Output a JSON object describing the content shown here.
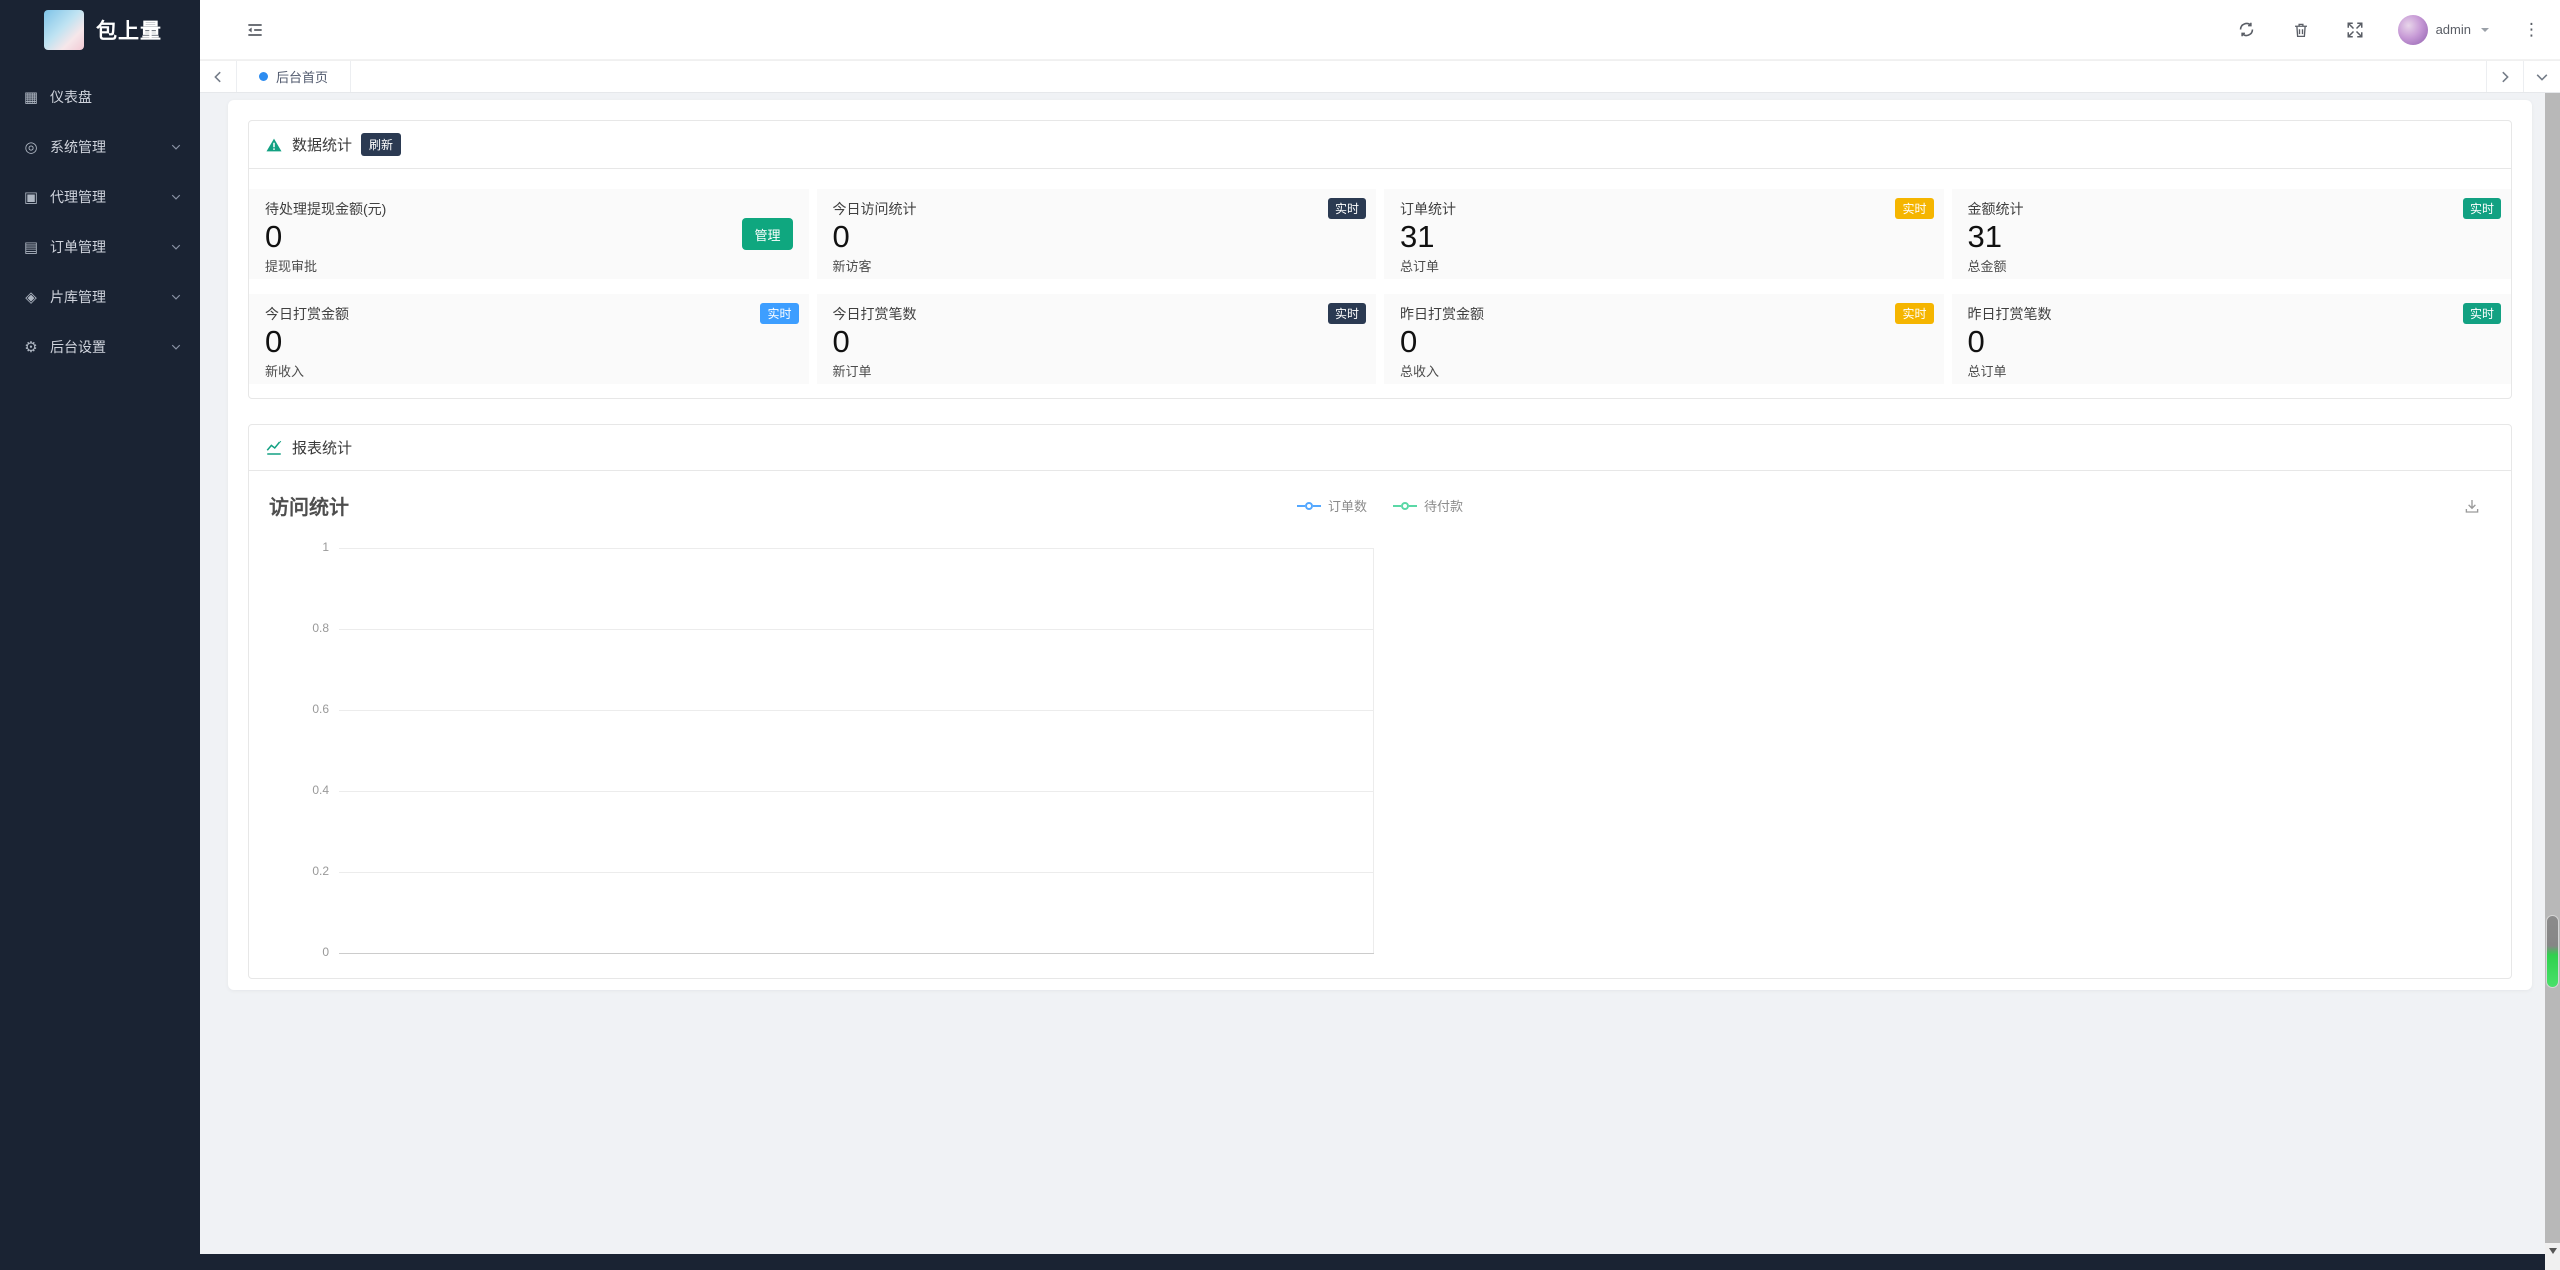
{
  "app": {
    "logo_text": "包上量"
  },
  "sidebar": {
    "items": [
      {
        "label": "仪表盘",
        "glyph": "▦",
        "expandable": false
      },
      {
        "label": "系统管理",
        "glyph": "◎",
        "expandable": true
      },
      {
        "label": "代理管理",
        "glyph": "▣",
        "expandable": true
      },
      {
        "label": "订单管理",
        "glyph": "▤",
        "expandable": true
      },
      {
        "label": "片库管理",
        "glyph": "◈",
        "expandable": true
      },
      {
        "label": "后台设置",
        "glyph": "⚙",
        "expandable": true
      }
    ]
  },
  "header": {
    "username": "admin"
  },
  "tabbar": {
    "active_tab": "后台首页"
  },
  "stats": {
    "section_title": "数据统计",
    "refresh_badge": "刷新",
    "cards": [
      {
        "title": "待处理提现金额(元)",
        "value": "0",
        "sub": "提现审批",
        "action_label": "管理",
        "action_bg": "#0fa77f"
      },
      {
        "title": "今日访问统计",
        "value": "0",
        "sub": "新访客",
        "badge": "实时",
        "badge_bg": "#2b3a52"
      },
      {
        "title": "订单统计",
        "value": "31",
        "sub": "总订单",
        "badge": "实时",
        "badge_bg": "#f5b500"
      },
      {
        "title": "金额统计",
        "value": "31",
        "sub": "总金额",
        "badge": "实时",
        "badge_bg": "#12a182"
      },
      {
        "title": "今日打赏金额",
        "value": "0",
        "sub": "新收入",
        "badge": "实时",
        "badge_bg": "#3d9eff"
      },
      {
        "title": "今日打赏笔数",
        "value": "0",
        "sub": "新订单",
        "badge": "实时",
        "badge_bg": "#2b3a52"
      },
      {
        "title": "昨日打赏金额",
        "value": "0",
        "sub": "总收入",
        "badge": "实时",
        "badge_bg": "#f5b500"
      },
      {
        "title": "昨日打赏笔数",
        "value": "0",
        "sub": "总订单",
        "badge": "实时",
        "badge_bg": "#12a182"
      }
    ]
  },
  "report": {
    "section_title": "报表统计",
    "chart_title": "访问统计",
    "legend": [
      {
        "label": "订单数",
        "color": "#54a8ff"
      },
      {
        "label": "待付款",
        "color": "#5ad8a6"
      }
    ],
    "yticks": [
      "1",
      "0.8",
      "0.6",
      "0.4",
      "0.2",
      "0"
    ]
  },
  "chart_data": {
    "type": "line",
    "title": "访问统计",
    "series": [
      {
        "name": "订单数",
        "x": [],
        "y": []
      },
      {
        "name": "待付款",
        "x": [],
        "y": []
      }
    ],
    "ylim": [
      0,
      1
    ],
    "yticks": [
      0,
      0.2,
      0.4,
      0.6,
      0.8,
      1
    ],
    "legend_position": "top-center",
    "grid": "horizontal"
  },
  "colors": {
    "sidebar_bg": "#1a2333",
    "accent_teal": "#12a182",
    "accent_yellow": "#f5b500",
    "accent_blue": "#3d9eff",
    "badge_dark": "#2b3a52",
    "tab_dot": "#2d8cf0",
    "scroll_thumb_green": "#35d04a"
  }
}
